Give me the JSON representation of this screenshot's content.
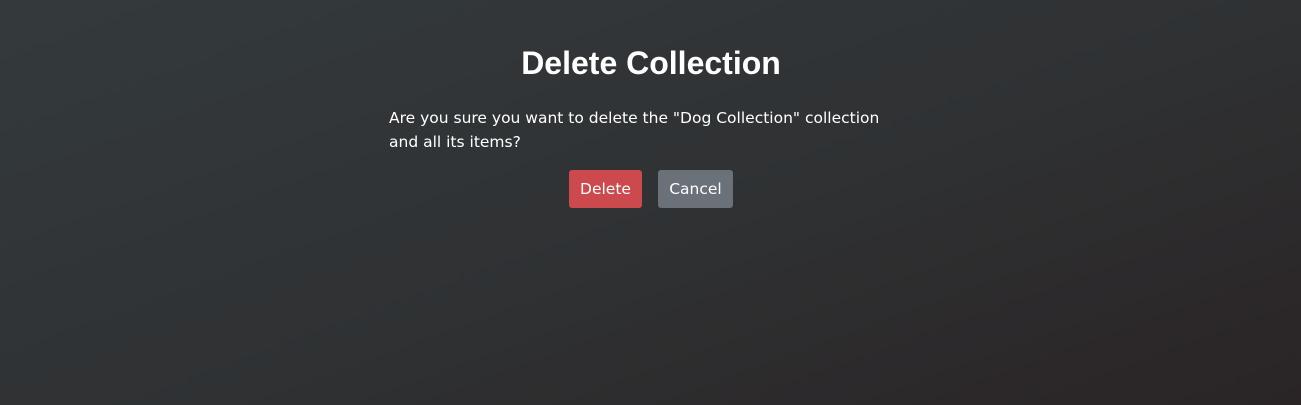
{
  "dialog": {
    "title": "Delete Collection",
    "message": "Are you sure you want to delete the \"Dog Collection\" collection and all its items?",
    "delete_label": "Delete",
    "cancel_label": "Cancel"
  },
  "colors": {
    "delete_button": "#cc4a4d",
    "cancel_button": "#6b7178",
    "text": "#ffffff"
  }
}
